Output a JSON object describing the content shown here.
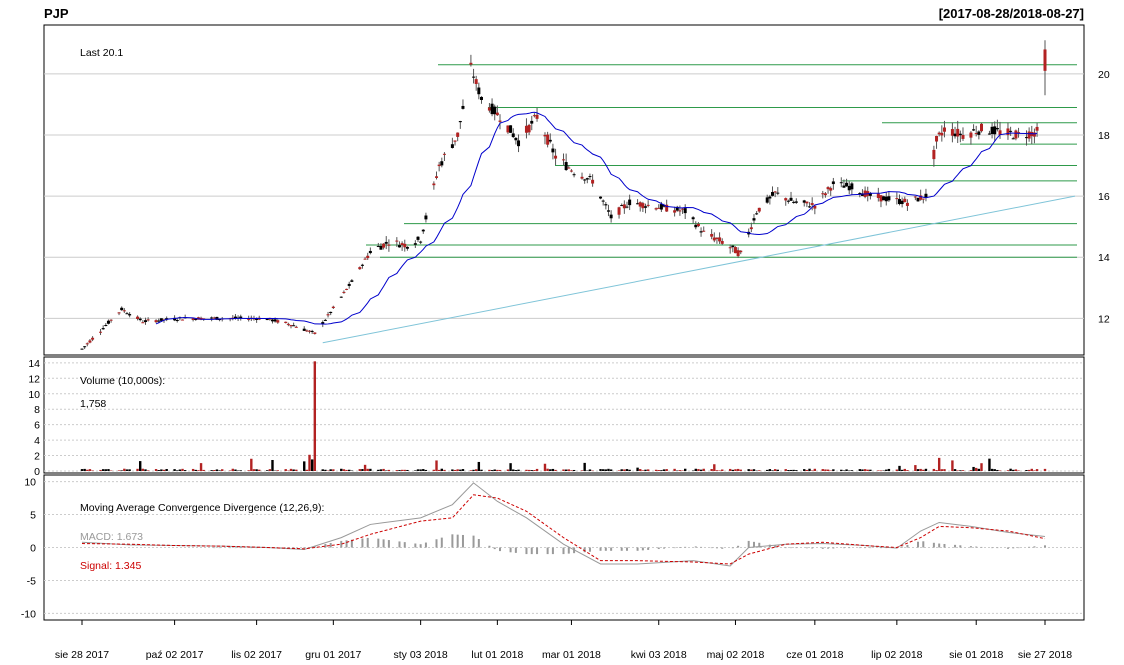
{
  "title": "PJP",
  "date_range": "[2017-08-28/2018-08-27]",
  "colors": {
    "up_candle": "#000000",
    "down_candle": "#b22222",
    "sma": "#0000cc",
    "horizontal_levels": "#2e9a4a",
    "trendline": "#7fc4d8",
    "macd": "#999999",
    "signal": "#cc0000",
    "histogram": "#9a9a9a",
    "grid": "#cccccc"
  },
  "chart_data": [
    {
      "type": "candlestick",
      "panel": "price",
      "label": "Last 20.1",
      "ylim": [
        10.8,
        21.6
      ],
      "y_ticks": [
        12,
        14,
        16,
        18,
        20
      ],
      "grid": true,
      "overlays": [
        "SMA (blue line)",
        "horizontal support/resistance lines",
        "ascending trendline"
      ],
      "horizontal_levels": [
        20.3,
        18.9,
        18.4,
        17.7,
        17.0,
        16.5,
        15.1,
        14.4,
        14.0
      ],
      "trendline": {
        "from": [
          "2017-11-27",
          11.2
        ],
        "to": [
          "2018-08-27",
          16.0
        ]
      },
      "last": 20.1
    },
    {
      "type": "bar",
      "panel": "volume",
      "label": "Volume (10,000s):",
      "value_label": "1,758",
      "ylim": [
        0,
        14.5
      ],
      "y_ticks": [
        0,
        2,
        4,
        6,
        8,
        10,
        12,
        14
      ],
      "grid": true,
      "peak": {
        "date": "2017-11-24",
        "value": 14.2
      }
    },
    {
      "type": "line",
      "panel": "macd",
      "label": "Moving Average Convergence Divergence (12,26,9):",
      "macd_label": "MACD: 1.673",
      "signal_label": "Signal: 1.345",
      "ylim": [
        -11,
        11
      ],
      "y_ticks": [
        10,
        5,
        0,
        -5,
        -10
      ],
      "grid": true,
      "series": [
        {
          "name": "MACD",
          "values": [
            [
              "2017-08-28",
              0.8
            ],
            [
              "2017-09-15",
              0.4
            ],
            [
              "2017-10-02",
              0.3
            ],
            [
              "2017-10-20",
              0.2
            ],
            [
              "2017-11-06",
              0.0
            ],
            [
              "2017-11-20",
              -0.3
            ],
            [
              "2017-12-04",
              1.5
            ],
            [
              "2017-12-15",
              3.5
            ],
            [
              "2018-01-03",
              4.5
            ],
            [
              "2018-01-15",
              6.5
            ],
            [
              "2018-01-23",
              9.8
            ],
            [
              "2018-02-01",
              7.0
            ],
            [
              "2018-02-12",
              4.5
            ],
            [
              "2018-02-26",
              0.5
            ],
            [
              "2018-03-12",
              -2.5
            ],
            [
              "2018-03-26",
              -2.5
            ],
            [
              "2018-04-16",
              -2.0
            ],
            [
              "2018-04-30",
              -2.8
            ],
            [
              "2018-05-07",
              0.0
            ],
            [
              "2018-05-21",
              0.5
            ],
            [
              "2018-06-04",
              0.6
            ],
            [
              "2018-06-20",
              0.3
            ],
            [
              "2018-07-02",
              -0.1
            ],
            [
              "2018-07-11",
              2.5
            ],
            [
              "2018-07-18",
              3.8
            ],
            [
              "2018-07-30",
              3.2
            ],
            [
              "2018-08-13",
              2.3
            ],
            [
              "2018-08-27",
              1.673
            ]
          ]
        },
        {
          "name": "Signal",
          "values": [
            [
              "2017-08-28",
              0.6
            ],
            [
              "2017-09-15",
              0.5
            ],
            [
              "2017-10-02",
              0.3
            ],
            [
              "2017-10-20",
              0.2
            ],
            [
              "2017-11-06",
              0.0
            ],
            [
              "2017-11-20",
              -0.2
            ],
            [
              "2017-12-04",
              0.5
            ],
            [
              "2017-12-15",
              2.0
            ],
            [
              "2018-01-03",
              4.0
            ],
            [
              "2018-01-15",
              4.5
            ],
            [
              "2018-01-23",
              8.0
            ],
            [
              "2018-02-01",
              7.5
            ],
            [
              "2018-02-12",
              5.5
            ],
            [
              "2018-02-26",
              1.5
            ],
            [
              "2018-03-12",
              -2.0
            ],
            [
              "2018-03-26",
              -2.0
            ],
            [
              "2018-04-16",
              -2.2
            ],
            [
              "2018-04-30",
              -2.5
            ],
            [
              "2018-05-07",
              -1.0
            ],
            [
              "2018-05-21",
              0.5
            ],
            [
              "2018-06-04",
              0.8
            ],
            [
              "2018-06-20",
              0.3
            ],
            [
              "2018-07-02",
              0.0
            ],
            [
              "2018-07-11",
              1.5
            ],
            [
              "2018-07-18",
              3.2
            ],
            [
              "2018-07-30",
              3.0
            ],
            [
              "2018-08-13",
              2.5
            ],
            [
              "2018-08-27",
              1.345
            ]
          ]
        }
      ]
    }
  ],
  "x_axis": {
    "start": "2017-08-28",
    "end": "2018-08-27",
    "tick_labels": [
      {
        "date": "2017-08-28",
        "label": "sie 28 2017"
      },
      {
        "date": "2017-10-02",
        "label": "paź 02 2017"
      },
      {
        "date": "2017-11-02",
        "label": "lis 02 2017"
      },
      {
        "date": "2017-12-01",
        "label": "gru 01 2017"
      },
      {
        "date": "2018-01-03",
        "label": "sty 03 2018"
      },
      {
        "date": "2018-02-01",
        "label": "lut 01 2018"
      },
      {
        "date": "2018-03-01",
        "label": "mar 01 2018"
      },
      {
        "date": "2018-04-03",
        "label": "kwi 03 2018"
      },
      {
        "date": "2018-05-02",
        "label": "maj 02 2018"
      },
      {
        "date": "2018-06-01",
        "label": "cze 01 2018"
      },
      {
        "date": "2018-07-02",
        "label": "lip 02 2018"
      },
      {
        "date": "2018-08-01",
        "label": "sie 01 2018"
      },
      {
        "date": "2018-08-27",
        "label": "sie 27 2018"
      }
    ]
  }
}
